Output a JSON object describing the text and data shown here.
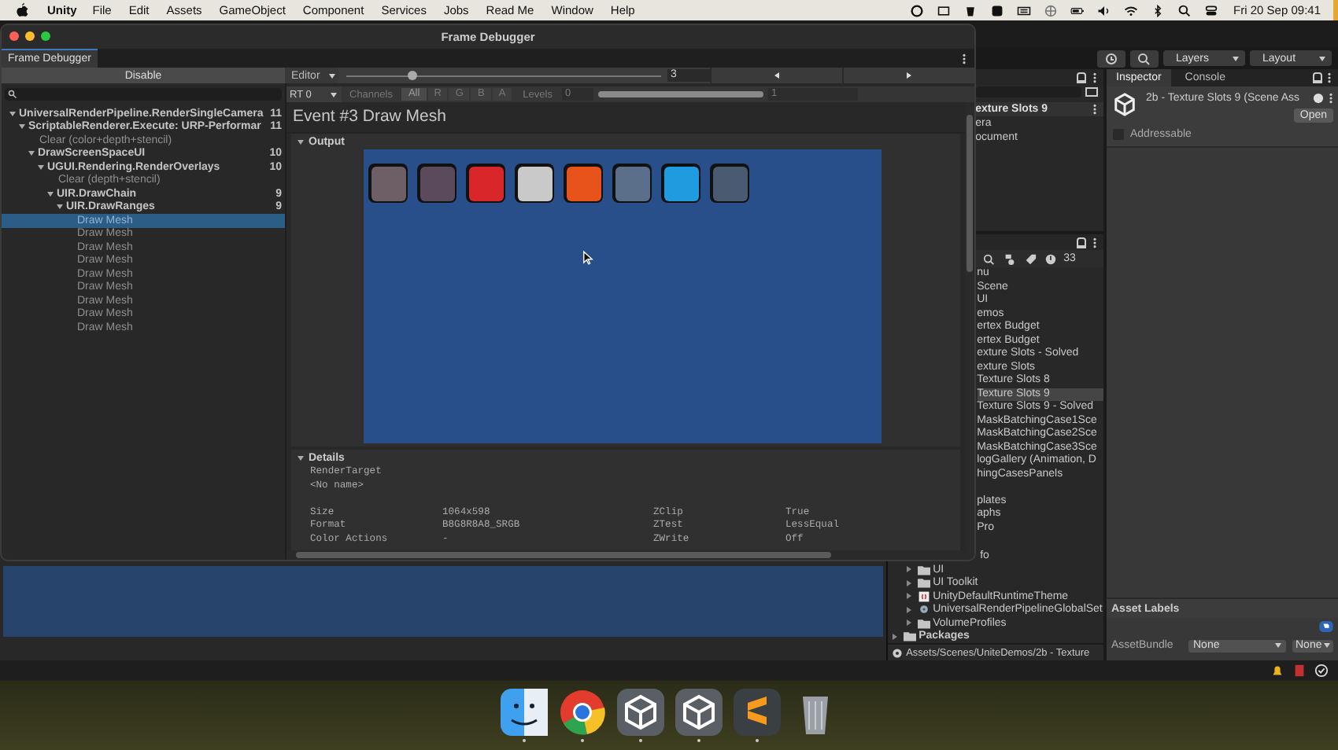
{
  "menu_bar": {
    "app": "Unity",
    "menus": [
      "File",
      "Edit",
      "Assets",
      "GameObject",
      "Component",
      "Services",
      "Jobs",
      "Read Me",
      "Window",
      "Help"
    ],
    "clock": "Fri 20 Sep 09:41"
  },
  "editor": {
    "toolbar": {
      "layers": "Layers",
      "layout": "Layout"
    },
    "hierarchy": {
      "header": "exture Slots 9",
      "items": [
        "era",
        "ocument"
      ]
    },
    "project": {
      "count": "33",
      "upper_items": [
        {
          "label": "nu",
          "selected": false
        },
        {
          "label": "Scene",
          "selected": false
        },
        {
          "label": "UI",
          "selected": false
        },
        {
          "label": "emos",
          "selected": false
        },
        {
          "label": "ertex Budget",
          "selected": false
        },
        {
          "label": "ertex Budget",
          "selected": false
        },
        {
          "label": "exture Slots - Solved",
          "selected": false
        },
        {
          "label": "exture Slots",
          "selected": false
        },
        {
          "label": "Texture Slots 8",
          "selected": false
        },
        {
          "label": "Texture Slots 9",
          "selected": true
        },
        {
          "label": "Texture Slots 9 - Solved",
          "selected": false
        },
        {
          "label": "MaskBatchingCase1Sce",
          "selected": false
        },
        {
          "label": "MaskBatchingCase2Sce",
          "selected": false
        },
        {
          "label": "MaskBatchingCase3Sce",
          "selected": false
        },
        {
          "label": "logGallery (Animation, D",
          "selected": false
        },
        {
          "label": "hingCasesPanels",
          "selected": false
        }
      ],
      "middle_items": [
        "plates",
        "aphs",
        "Pro"
      ],
      "lower_items": [
        {
          "label": "fo",
          "kind": "cut"
        },
        {
          "label": "UI",
          "kind": "folder"
        },
        {
          "label": "UI Toolkit",
          "kind": "folder"
        },
        {
          "label": "UnityDefaultRuntimeTheme",
          "kind": "theme"
        },
        {
          "label": "UniversalRenderPipelineGlobalSet",
          "kind": "settings"
        },
        {
          "label": "VolumeProfiles",
          "kind": "folder"
        },
        {
          "label": "Packages",
          "kind": "root_folder"
        }
      ],
      "path": "Assets/Scenes/UniteDemos/2b - Texture"
    },
    "inspector": {
      "tabs": [
        {
          "label": "Inspector",
          "selected": true
        },
        {
          "label": "Console",
          "selected": false
        }
      ],
      "title": "2b - Texture Slots 9 (Scene Ass",
      "open_button": "Open",
      "addressable": {
        "label": "Addressable",
        "checked": false
      },
      "asset_labels": "Asset Labels",
      "asset_bundle": {
        "label": "AssetBundle",
        "value": "None",
        "variant": "None"
      }
    }
  },
  "frame_debugger": {
    "title": "Frame Debugger",
    "tab": "Frame Debugger",
    "disable_button": "Disable",
    "target": "Editor",
    "event_slider": {
      "level": 0.21
    },
    "event_number": "3",
    "tree": [
      {
        "label": "UniversalRenderPipeline.RenderSingleCamera",
        "count": "11",
        "expanded": true,
        "selected": false,
        "children": [
          {
            "label": "ScriptableRenderer.Execute: URP-Performar",
            "count": "11",
            "expanded": true,
            "selected": false,
            "children": [
              {
                "label": "Clear (color+depth+stencil)",
                "selected": false
              },
              {
                "label": "DrawScreenSpaceUI",
                "count": "10",
                "expanded": true,
                "selected": false,
                "children": [
                  {
                    "label": "UGUI.Rendering.RenderOverlays",
                    "count": "10",
                    "expanded": true,
                    "selected": false,
                    "children": [
                      {
                        "label": "Clear (depth+stencil)",
                        "selected": false
                      },
                      {
                        "label": "UIR.DrawChain",
                        "count": "9",
                        "expanded": true,
                        "selected": false,
                        "children": [
                          {
                            "label": "UIR.DrawRanges",
                            "count": "9",
                            "expanded": true,
                            "selected": false,
                            "children": [
                              {
                                "label": "Draw Mesh",
                                "selected": true
                              },
                              {
                                "label": "Draw Mesh",
                                "selected": false
                              },
                              {
                                "label": "Draw Mesh",
                                "selected": false
                              },
                              {
                                "label": "Draw Mesh",
                                "selected": false
                              },
                              {
                                "label": "Draw Mesh",
                                "selected": false
                              },
                              {
                                "label": "Draw Mesh",
                                "selected": false
                              },
                              {
                                "label": "Draw Mesh",
                                "selected": false
                              },
                              {
                                "label": "Draw Mesh",
                                "selected": false
                              },
                              {
                                "label": "Draw Mesh",
                                "selected": false
                              }
                            ]
                          }
                        ]
                      }
                    ]
                  }
                ]
              }
            ]
          }
        ]
      }
    ],
    "rt": "RT 0",
    "channels_label": "Channels",
    "channels": [
      {
        "label": "All",
        "selected": true
      },
      {
        "label": "R",
        "selected": false
      },
      {
        "label": "G",
        "selected": false
      },
      {
        "label": "B",
        "selected": false
      },
      {
        "label": "A",
        "selected": false
      }
    ],
    "levels_label": "Levels",
    "levels_min": "0",
    "levels_max": "1",
    "levels_range": {
      "level": 1
    },
    "event_title": "Event #3 Draw Mesh",
    "output_label": "Output",
    "thumbnails": [
      {
        "color": "#6e5f66"
      },
      {
        "color": "#5a4a5c"
      },
      {
        "color": "#d8262a"
      },
      {
        "color": "#c9c9c9"
      },
      {
        "color": "#e8531b"
      },
      {
        "color": "#5c6f8a"
      },
      {
        "color": "#1f9be0"
      },
      {
        "color": "#4a5a70"
      }
    ],
    "details_label": "Details",
    "render_target": "RenderTarget",
    "target_name": "<No name>",
    "details": [
      [
        "Size",
        "1064x598",
        "ZClip",
        "True"
      ],
      [
        "Format",
        "B8G8R8A8_SRGB",
        "ZTest",
        "LessEqual"
      ],
      [
        "Color Actions",
        "-",
        "ZWrite",
        "Off"
      ]
    ]
  },
  "dock": {
    "apps": [
      {
        "kind": "finder",
        "running": true
      },
      {
        "kind": "chrome",
        "running": true
      },
      {
        "kind": "unity",
        "running": true
      },
      {
        "kind": "unity",
        "running": true
      },
      {
        "kind": "sublime",
        "running": true
      },
      {
        "kind": "trash",
        "running": false
      }
    ]
  }
}
